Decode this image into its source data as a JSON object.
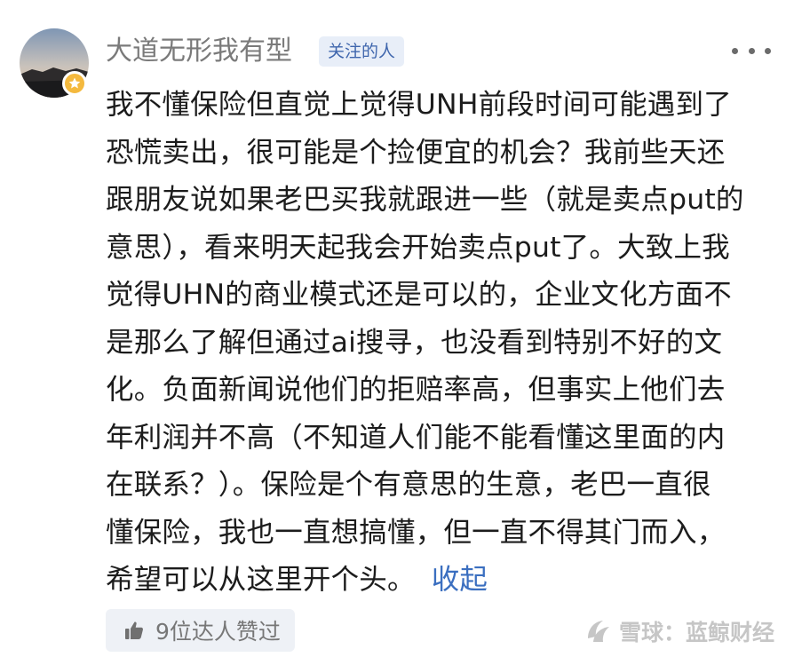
{
  "post": {
    "author": "大道无形我有型",
    "follow_tag": "关注的人",
    "body_lines": [
      "我不懂保险但直觉上觉得UNH前段时间可能遇到了",
      "恐慌卖出，很可能是个捡便宜的机会？我前些天还",
      "跟朋友说如果老巴买我就跟进一些（就是卖点put的",
      "意思），看来明天起我会开始卖点put了。大致上我",
      "觉得UHN的商业模式还是可以的，企业文化方面不",
      "是那么了解但通过ai搜寻，也没看到特别不好的文",
      "化。负面新闻说他们的拒赔率高，但事实上他们去",
      "年利润并不高（不知道人们能不能看懂这里面的内",
      "在联系？）。保险是个有意思的生意，老巴一直很",
      "懂保险，我也一直想搞懂，但一直不得其门而入，",
      "希望可以从这里开个头。"
    ],
    "collapse_label": "收起",
    "likes_label": "9位达人赞过"
  },
  "watermark": {
    "text": "雪球：蓝鲸财经"
  },
  "icons": {
    "more": "more-dots-icon",
    "like": "thumbs-up-icon",
    "badge": "star-badge-icon",
    "watermark_logo": "snowball-logo-icon"
  },
  "colors": {
    "link": "#3b6fc0",
    "tag_bg": "#e8eef8",
    "tag_text": "#3f66ad",
    "badge": "#f4b93e",
    "username": "#7a7a7a"
  }
}
